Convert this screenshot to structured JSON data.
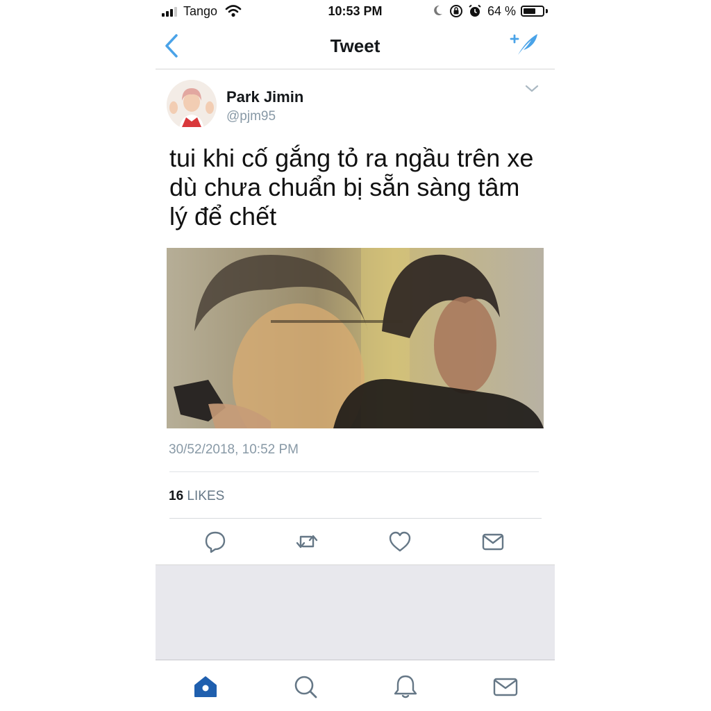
{
  "status_bar": {
    "carrier": "Tango",
    "time": "10:53 PM",
    "battery_percent": "64 %",
    "battery_level": 0.64,
    "signal_bars": 3
  },
  "nav": {
    "title": "Tweet",
    "back_icon": "chevron-left-icon",
    "compose_icon": "compose-tweet-icon"
  },
  "tweet": {
    "author_name": "Park Jimin",
    "author_handle": "@pjm95",
    "text": "tui khi cố gắng tỏ ra ngầu trên xe dù chưa chuẩn bị sẵn sàng tâm lý để chết",
    "timestamp": "30/52/2018, 10:52 PM",
    "likes_count": "16",
    "likes_label": "LIKES"
  },
  "actions": [
    "reply-icon",
    "retweet-icon",
    "like-icon",
    "direct-message-icon"
  ],
  "tab_bar": [
    "home-icon",
    "search-icon",
    "notifications-icon",
    "messages-icon"
  ],
  "colors": {
    "accent": "#1da1f2",
    "nav_icon": "#4aa3e8",
    "home_active": "#1f5fae",
    "secondary_text": "#8899a6",
    "icon_gray": "#657786"
  }
}
